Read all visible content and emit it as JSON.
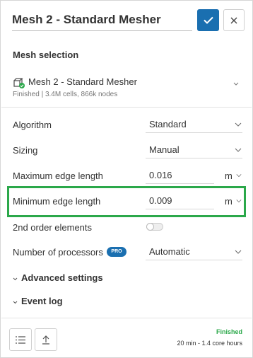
{
  "header": {
    "title": "Mesh 2 - Standard Mesher",
    "ok_icon": "check-icon",
    "close_icon": "close-icon"
  },
  "mesh_selection": {
    "heading": "Mesh selection",
    "name": "Mesh 2 - Standard Mesher",
    "meta": "Finished | 3.4M cells, 866k nodes"
  },
  "settings": {
    "algorithm": {
      "label": "Algorithm",
      "value": "Standard"
    },
    "sizing": {
      "label": "Sizing",
      "value": "Manual"
    },
    "max_edge": {
      "label": "Maximum edge length",
      "value": "0.016",
      "unit": "m"
    },
    "min_edge": {
      "label": "Minimum edge length",
      "value": "0.009",
      "unit": "m"
    },
    "second_order": {
      "label": "2nd order elements",
      "enabled": false
    },
    "processors": {
      "label": "Number of processors",
      "badge": "PRO",
      "value": "Automatic"
    }
  },
  "sections": {
    "advanced": "Advanced settings",
    "event_log": "Event log"
  },
  "footer": {
    "status": "Finished",
    "timing": "20 min - 1.4 core hours"
  },
  "colors": {
    "accent": "#1a6fb0",
    "highlight": "#2ba84a",
    "status": "#2ba84a"
  }
}
